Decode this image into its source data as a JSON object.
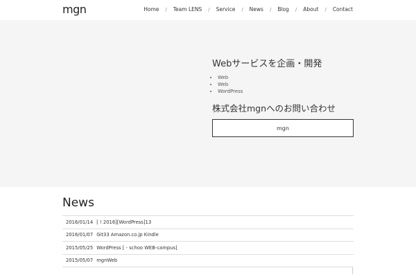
{
  "header": {
    "logo": "mgn",
    "nav": [
      "Home",
      "Team LENS",
      "Service",
      "News",
      "Blog",
      "About",
      "Contact"
    ],
    "separator": "/"
  },
  "hero": {
    "heading": "Webサービスを企画・開発",
    "list": [
      "Web",
      "Web",
      "WordPress"
    ],
    "subheading": "株式会社mgnへのお問い合わせ",
    "button_label": "mgn"
  },
  "news": {
    "title": "News",
    "items": [
      {
        "date": "2016/01/14",
        "text": "[ ! 2016][WordPress]13"
      },
      {
        "date": "2016/01/07",
        "text": "Git33  Amazon.co.jp Kindle"
      },
      {
        "date": "2015/05/25",
        "text": "WordPress  [ - schoo WEB-campus]"
      },
      {
        "date": "2015/05/07",
        "text": "mgnWeb"
      }
    ]
  }
}
